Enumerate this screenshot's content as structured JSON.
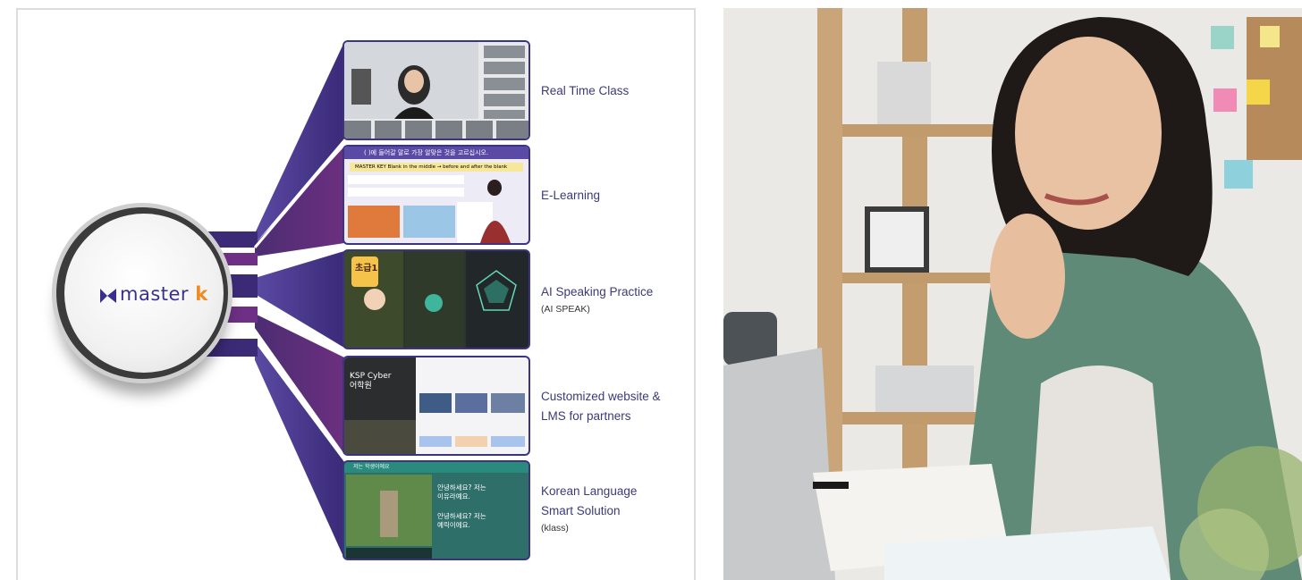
{
  "logo": {
    "brand_main": "master ",
    "brand_accent": "k"
  },
  "services": [
    {
      "title": "Real Time Class",
      "subtitle": ""
    },
    {
      "title": "E-Learning",
      "subtitle": ""
    },
    {
      "title": "AI Speaking Practice",
      "subtitle": "(AI SPEAK)"
    },
    {
      "title_line1": "Customized website &",
      "title_line2": "LMS for partners"
    },
    {
      "title_line1": "Korean Language",
      "title_line2": "Smart Solution",
      "subtitle": "(klass)"
    }
  ],
  "thumbs": {
    "elearning_header": "(        )에 들어갈 말로 가장 알맞은 것을 고르십시오.",
    "elearning_key": "MASTER KEY  Blank in the middle → before and after the blank",
    "speak_badge": "초급1",
    "lms_title_1": "KSP Cyber",
    "lms_title_2": "어학원",
    "klass_header": "저는 학생이에요",
    "klass_chat_1_a": "안녕하세요? 저는",
    "klass_chat_1_b": "이유라예요.",
    "klass_chat_2_a": "안녕하세요? 저는",
    "klass_chat_2_b": "예릭이에요."
  },
  "colors": {
    "brand_purple": "#3a2f8c",
    "brand_orange": "#f08a24",
    "connector_dark": "#3f2a72",
    "connector_light": "#6a66b8"
  }
}
